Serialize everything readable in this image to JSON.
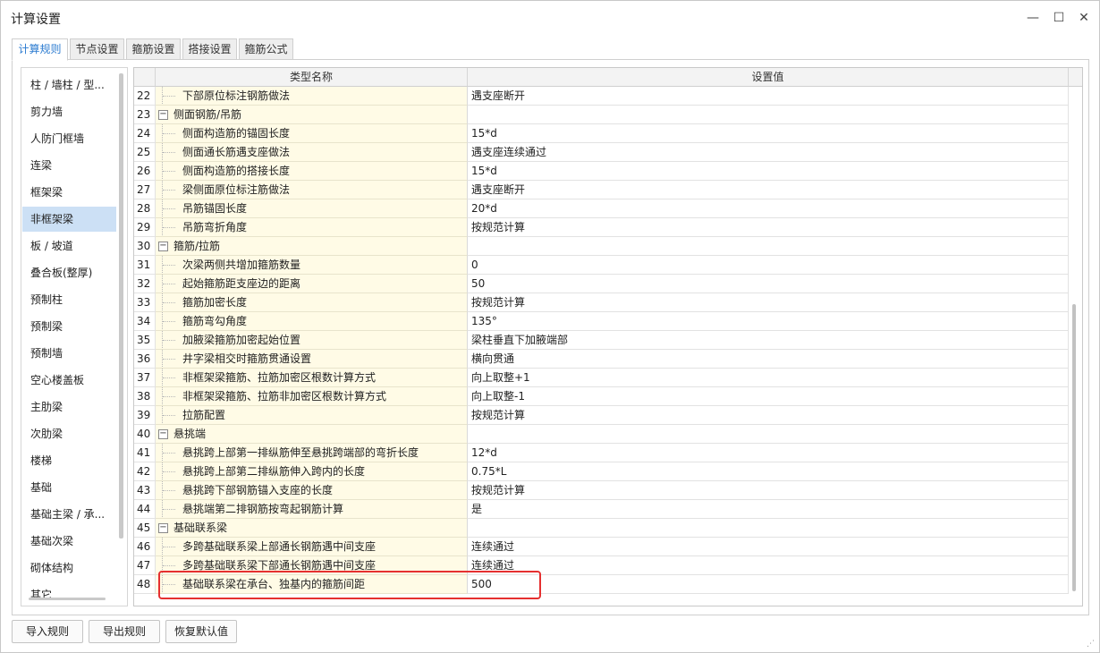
{
  "window": {
    "title": "计算设置",
    "minimize_glyph": "—",
    "maximize_glyph": "☐",
    "close_glyph": "✕"
  },
  "tabs": [
    {
      "label": "计算规则",
      "active": true
    },
    {
      "label": "节点设置",
      "active": false
    },
    {
      "label": "箍筋设置",
      "active": false
    },
    {
      "label": "搭接设置",
      "active": false
    },
    {
      "label": "箍筋公式",
      "active": false
    }
  ],
  "sidebar": {
    "items": [
      {
        "label": "柱 / 墙柱 / 型..."
      },
      {
        "label": "剪力墙"
      },
      {
        "label": "人防门框墙"
      },
      {
        "label": "连梁"
      },
      {
        "label": "框架梁"
      },
      {
        "label": "非框架梁",
        "selected": true
      },
      {
        "label": "板 / 坡道"
      },
      {
        "label": "叠合板(整厚)"
      },
      {
        "label": "预制柱"
      },
      {
        "label": "预制梁"
      },
      {
        "label": "预制墙"
      },
      {
        "label": "空心楼盖板"
      },
      {
        "label": "主肋梁"
      },
      {
        "label": "次肋梁"
      },
      {
        "label": "楼梯"
      },
      {
        "label": "基础"
      },
      {
        "label": "基础主梁 / 承..."
      },
      {
        "label": "基础次梁"
      },
      {
        "label": "砌体结构"
      },
      {
        "label": "其它"
      }
    ]
  },
  "grid": {
    "headers": {
      "name": "类型名称",
      "value": "设置值"
    },
    "toggle_glyph": "−",
    "rows": [
      {
        "no": "22",
        "name": "下部原位标注钢筋做法",
        "value": "遇支座断开",
        "group": false
      },
      {
        "no": "23",
        "name": "侧面钢筋/吊筋",
        "value": "",
        "group": true
      },
      {
        "no": "24",
        "name": "侧面构造筋的锚固长度",
        "value": "15*d",
        "group": false
      },
      {
        "no": "25",
        "name": "侧面通长筋遇支座做法",
        "value": "遇支座连续通过",
        "group": false
      },
      {
        "no": "26",
        "name": "侧面构造筋的搭接长度",
        "value": "15*d",
        "group": false
      },
      {
        "no": "27",
        "name": "梁侧面原位标注筋做法",
        "value": "遇支座断开",
        "group": false
      },
      {
        "no": "28",
        "name": "吊筋锚固长度",
        "value": "20*d",
        "group": false
      },
      {
        "no": "29",
        "name": "吊筋弯折角度",
        "value": "按规范计算",
        "group": false
      },
      {
        "no": "30",
        "name": "箍筋/拉筋",
        "value": "",
        "group": true
      },
      {
        "no": "31",
        "name": "次梁两侧共增加箍筋数量",
        "value": "0",
        "group": false
      },
      {
        "no": "32",
        "name": "起始箍筋距支座边的距离",
        "value": "50",
        "group": false
      },
      {
        "no": "33",
        "name": "箍筋加密长度",
        "value": "按规范计算",
        "group": false
      },
      {
        "no": "34",
        "name": "箍筋弯勾角度",
        "value": "135°",
        "group": false
      },
      {
        "no": "35",
        "name": "加腋梁箍筋加密起始位置",
        "value": "梁柱垂直下加腋端部",
        "group": false
      },
      {
        "no": "36",
        "name": "井字梁相交时箍筋贯通设置",
        "value": "横向贯通",
        "group": false
      },
      {
        "no": "37",
        "name": "非框架梁箍筋、拉筋加密区根数计算方式",
        "value": "向上取整+1",
        "group": false
      },
      {
        "no": "38",
        "name": "非框架梁箍筋、拉筋非加密区根数计算方式",
        "value": "向上取整-1",
        "group": false
      },
      {
        "no": "39",
        "name": "拉筋配置",
        "value": "按规范计算",
        "group": false
      },
      {
        "no": "40",
        "name": "悬挑端",
        "value": "",
        "group": true
      },
      {
        "no": "41",
        "name": "悬挑跨上部第一排纵筋伸至悬挑跨端部的弯折长度",
        "value": "12*d",
        "group": false
      },
      {
        "no": "42",
        "name": "悬挑跨上部第二排纵筋伸入跨内的长度",
        "value": "0.75*L",
        "group": false
      },
      {
        "no": "43",
        "name": "悬挑跨下部钢筋锚入支座的长度",
        "value": "按规范计算",
        "group": false
      },
      {
        "no": "44",
        "name": "悬挑端第二排钢筋按弯起钢筋计算",
        "value": "是",
        "group": false
      },
      {
        "no": "45",
        "name": "基础联系梁",
        "value": "",
        "group": true
      },
      {
        "no": "46",
        "name": "多跨基础联系梁上部通长钢筋遇中间支座",
        "value": "连续通过",
        "group": false
      },
      {
        "no": "47",
        "name": "多跨基础联系梁下部通长钢筋遇中间支座",
        "value": "连续通过",
        "group": false
      },
      {
        "no": "48",
        "name": "基础联系梁在承台、独基内的箍筋间距",
        "value": "500",
        "group": false
      }
    ]
  },
  "buttons": {
    "import": "导入规则",
    "export": "导出规则",
    "restore": "恢复默认值"
  },
  "colors": {
    "accent": "#2b7bd0",
    "selected_bg": "#cce0f5",
    "name_cell_bg": "#fffbe6",
    "highlight": "#e53030"
  }
}
